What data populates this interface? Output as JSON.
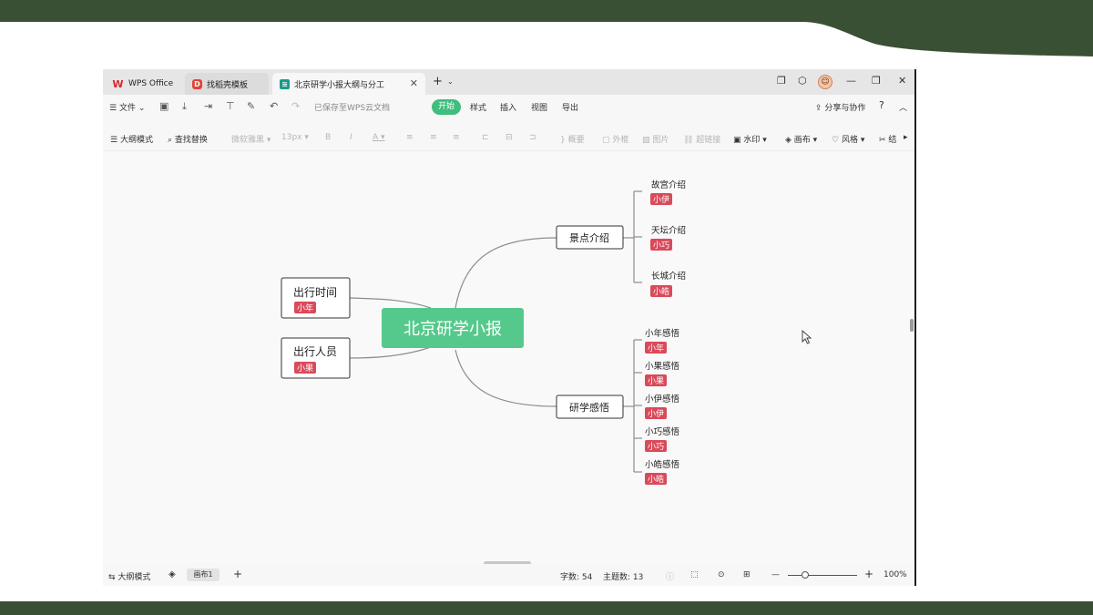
{
  "tabs": {
    "wps_office": "WPS Office",
    "template": "找稻壳模板",
    "document": "北京研学小报大纲与分工"
  },
  "menubar": {
    "file": "文件",
    "saved_status": "已保存至WPS云文档",
    "start": "开始",
    "style": "样式",
    "insert": "插入",
    "view": "视图",
    "export": "导出",
    "share": "分享与协作",
    "help": "?"
  },
  "toolbar": {
    "outline_mode": "大纲模式",
    "find_replace": "查找替换",
    "font_family": "微软雅黑",
    "font_size": "13px",
    "bold": "B",
    "italic": "I",
    "font_color": "A",
    "summary": "概要",
    "outer_frame": "外框",
    "image": "图片",
    "hyperlink": "超链接",
    "watermark": "水印",
    "canvas": "画布",
    "theme_style": "风格",
    "more": "结"
  },
  "mindmap": {
    "root": "北京研学小报",
    "left_nodes": [
      {
        "label": "出行时间",
        "tag": "小年"
      },
      {
        "label": "出行人员",
        "tag": "小果"
      }
    ],
    "branch_scenic": {
      "label": "景点介绍",
      "children": [
        {
          "label": "故宫介绍",
          "tag": "小伊"
        },
        {
          "label": "天坛介绍",
          "tag": "小巧"
        },
        {
          "label": "长城介绍",
          "tag": "小皓"
        }
      ]
    },
    "branch_reflection": {
      "label": "研学感悟",
      "children": [
        {
          "label": "小年感悟",
          "tag": "小年"
        },
        {
          "label": "小果感悟",
          "tag": "小果"
        },
        {
          "label": "小伊感悟",
          "tag": "小伊"
        },
        {
          "label": "小巧感悟",
          "tag": "小巧"
        },
        {
          "label": "小皓感悟",
          "tag": "小皓"
        }
      ]
    }
  },
  "statusbar": {
    "outline_mode": "大纲模式",
    "page_tab": "画布1",
    "word_count_label": "字数:",
    "word_count": "54",
    "topic_count_label": "主题数:",
    "topic_count": "13",
    "zoom": "100%"
  },
  "colors": {
    "root_fill": "#55c98b",
    "tag_fill": "#d94a5a",
    "branch_line": "#8c8c8c",
    "slide_band": "#3a5034",
    "start_button": "#3fbe7c"
  },
  "icons": {
    "app_logo": "wps-logo-icon",
    "cursor": "mouse-pointer-icon"
  }
}
